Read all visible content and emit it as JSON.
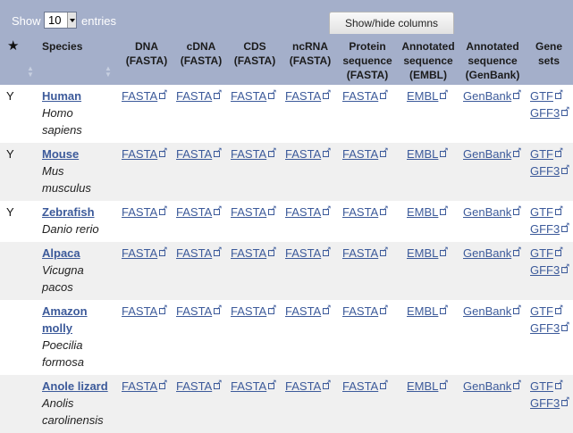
{
  "controls": {
    "show_label": "Show",
    "entries_value": "10",
    "entries_label": "entries",
    "columns_button": "Show/hide columns"
  },
  "header": {
    "species": "Species",
    "dna": [
      "DNA",
      "(FASTA)"
    ],
    "cdna": [
      "cDNA",
      "(FASTA)"
    ],
    "cds": [
      "CDS",
      "(FASTA)"
    ],
    "ncrna": [
      "ncRNA",
      "(FASTA)"
    ],
    "protein": [
      "Protein",
      "sequence",
      "(FASTA)"
    ],
    "embl": [
      "Annotated",
      "sequence",
      "(EMBL)"
    ],
    "genbank": [
      "Annotated",
      "sequence",
      "(GenBank)"
    ],
    "genesets": [
      "Gene",
      "sets"
    ]
  },
  "links": {
    "fasta": "FASTA",
    "embl": "EMBL",
    "genbank": "GenBank",
    "gtf": "GTF",
    "gff3": "GFF3"
  },
  "rows": [
    {
      "fav": "Y",
      "common": [
        "Human"
      ],
      "scientific": [
        "Homo sapiens"
      ]
    },
    {
      "fav": "Y",
      "common": [
        "Mouse"
      ],
      "scientific": [
        "Mus musculus"
      ]
    },
    {
      "fav": "Y",
      "common": [
        "Zebrafish"
      ],
      "scientific": [
        "Danio rerio"
      ]
    },
    {
      "fav": "",
      "common": [
        "Alpaca"
      ],
      "scientific": [
        "Vicugna",
        "pacos"
      ]
    },
    {
      "fav": "",
      "common": [
        "Amazon",
        "molly"
      ],
      "scientific": [
        "Poecilia",
        "formosa"
      ]
    },
    {
      "fav": "",
      "common": [
        "Anole lizard"
      ],
      "scientific": [
        "Anolis",
        "carolinensis"
      ]
    }
  ],
  "colors": {
    "header_bg": "#a4afca",
    "link": "#3c5a9a",
    "stripe": "#f0f0f0"
  },
  "icons": [
    "star-icon",
    "sort-icon",
    "external-link-icon",
    "dropdown-arrow-icon"
  ]
}
